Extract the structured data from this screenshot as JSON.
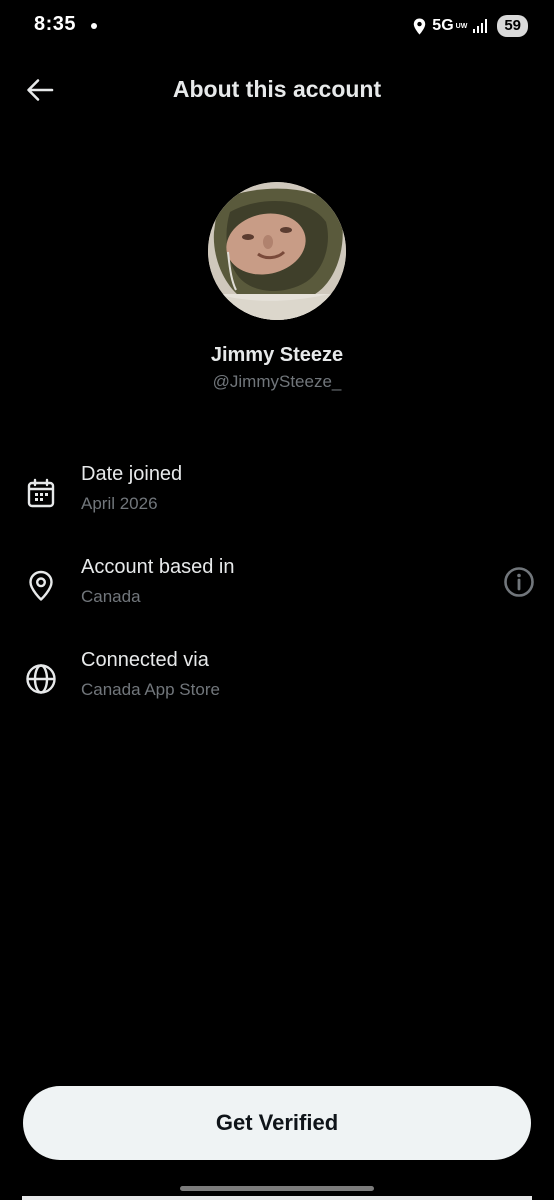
{
  "status_bar": {
    "time": "8:35",
    "network": "5G",
    "network_sub": "UW",
    "battery": "59",
    "icons": [
      "location-icon",
      "signal-icon"
    ]
  },
  "header": {
    "title": "About this account",
    "back_icon": "arrow-left-icon"
  },
  "profile": {
    "display_name": "Jimmy Steeze",
    "handle": "@JimmySteeze_"
  },
  "info": {
    "date_joined": {
      "label": "Date joined",
      "value": "April 2026",
      "icon": "calendar-icon"
    },
    "based_in": {
      "label": "Account based in",
      "value": "Canada",
      "icon": "location-pin-icon",
      "action_icon": "info-icon"
    },
    "connected_via": {
      "label": "Connected via",
      "value": "Canada App Store",
      "icon": "globe-icon"
    }
  },
  "footer": {
    "verify_label": "Get Verified"
  },
  "colors": {
    "background": "#000000",
    "primary_text": "#e7e9ea",
    "secondary_text": "#71767b",
    "button_bg": "#eff3f4",
    "button_text": "#0f1419"
  }
}
